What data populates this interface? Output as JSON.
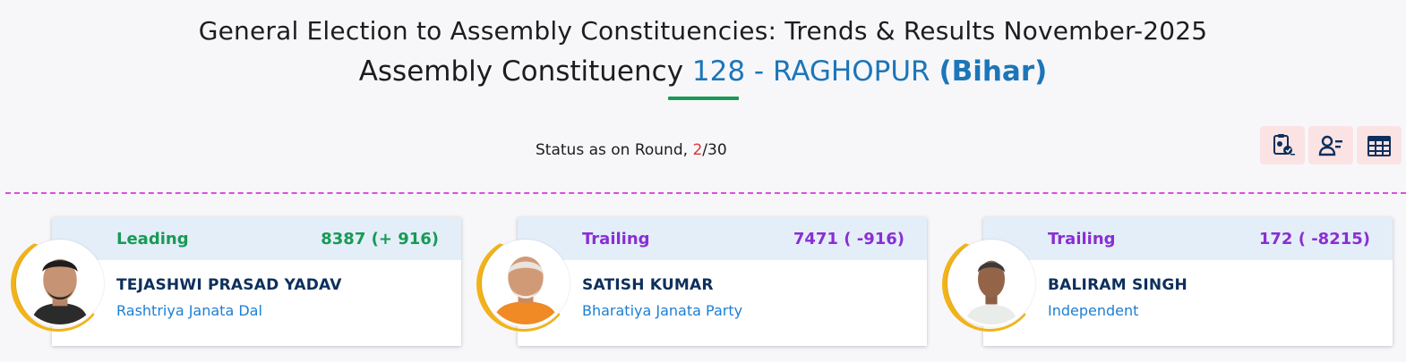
{
  "header": {
    "title": "General Election to Assembly Constituencies: Trends & Results November-2025",
    "subtitle_prefix": "Assembly Constituency ",
    "constituency": "128 - RAGHOPUR",
    "state": "(Bihar)"
  },
  "status": {
    "label": "Status as on Round, ",
    "current_round": "2",
    "separator": "/",
    "total_rounds": "30"
  },
  "toolbar": {
    "buttons": [
      {
        "icon": "clipboard-results-icon"
      },
      {
        "icon": "candidate-list-icon"
      },
      {
        "icon": "table-view-icon"
      }
    ]
  },
  "candidates": [
    {
      "status": "Leading",
      "votes": "8387 (+ 916)",
      "name": "TEJASHWI PRASAD YADAV",
      "party": "Rashtriya Janata Dal"
    },
    {
      "status": "Trailing",
      "votes": "7471 ( -916)",
      "name": "SATISH KUMAR",
      "party": "Bharatiya Janata Party"
    },
    {
      "status": "Trailing",
      "votes": "172 ( -8215)",
      "name": "BALIRAM SINGH",
      "party": "Independent"
    }
  ],
  "colors": {
    "leading": "#179a55",
    "trailing": "#8a2ed4",
    "accent": "#1c76b8",
    "divider": "#d94fe0"
  }
}
